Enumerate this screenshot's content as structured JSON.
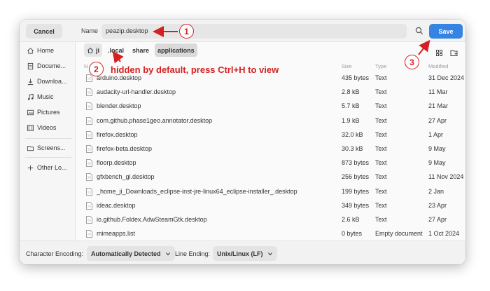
{
  "header": {
    "cancel_label": "Cancel",
    "name_label": "Name",
    "name_value": "peazip.desktop",
    "save_label": "Save"
  },
  "sidebar": {
    "items": [
      {
        "label": "Home",
        "icon": "home-icon"
      },
      {
        "label": "Docume...",
        "icon": "document-icon"
      },
      {
        "label": "Downloa...",
        "icon": "download-icon"
      },
      {
        "label": "Music",
        "icon": "music-icon"
      },
      {
        "label": "Pictures",
        "icon": "pictures-icon"
      },
      {
        "label": "Videos",
        "icon": "videos-icon"
      },
      {
        "label": "Screens...",
        "icon": "folder-icon"
      },
      {
        "label": "Other Lo...",
        "icon": "plus-icon"
      }
    ]
  },
  "path": {
    "crumbs": [
      "ji",
      ".local",
      "share",
      "applications"
    ]
  },
  "columns": {
    "name": "N",
    "size": "Size",
    "type": "Type",
    "modified": "Modified"
  },
  "files": [
    {
      "name": "arduino.desktop",
      "size": "435 bytes",
      "type": "Text",
      "modified": "31 Dec 2024"
    },
    {
      "name": "audacity-url-handler.desktop",
      "size": "2.8 kB",
      "type": "Text",
      "modified": "11 Mar"
    },
    {
      "name": "blender.desktop",
      "size": "5.7 kB",
      "type": "Text",
      "modified": "21 Mar"
    },
    {
      "name": "com.github.phase1geo.annotator.desktop",
      "size": "1.9 kB",
      "type": "Text",
      "modified": "27 Apr"
    },
    {
      "name": "firefox.desktop",
      "size": "32.0 kB",
      "type": "Text",
      "modified": "1 Apr"
    },
    {
      "name": "firefox-beta.desktop",
      "size": "30.3 kB",
      "type": "Text",
      "modified": "9 May"
    },
    {
      "name": "floorp.desktop",
      "size": "873 bytes",
      "type": "Text",
      "modified": "9 May"
    },
    {
      "name": "gfxbench_gl.desktop",
      "size": "256 bytes",
      "type": "Text",
      "modified": "11 Nov 2024"
    },
    {
      "name": "_home_ji_Downloads_eclipse-inst-jre-linux64_eclipse-installer_.desktop",
      "size": "199 bytes",
      "type": "Text",
      "modified": "2 Jan"
    },
    {
      "name": "ideac.desktop",
      "size": "349 bytes",
      "type": "Text",
      "modified": "23 Apr"
    },
    {
      "name": "io.github.Foldex.AdwSteamGtk.desktop",
      "size": "2.6 kB",
      "type": "Text",
      "modified": "27 Apr"
    },
    {
      "name": "mimeapps.list",
      "size": "0 bytes",
      "type": "Empty document",
      "modified": "1 Oct 2024"
    }
  ],
  "footer": {
    "encoding_label": "Character Encoding:",
    "encoding_value": "Automatically Detected",
    "line_ending_label": "Line Ending:",
    "line_ending_value": "Unix/Linux (LF)"
  },
  "annotations": {
    "circle1": "1",
    "circle2": "2",
    "circle3": "3",
    "note": "hidden by default, press Ctrl+H to view",
    "color": "#d42020"
  },
  "colors": {
    "accent": "#3584e4"
  }
}
